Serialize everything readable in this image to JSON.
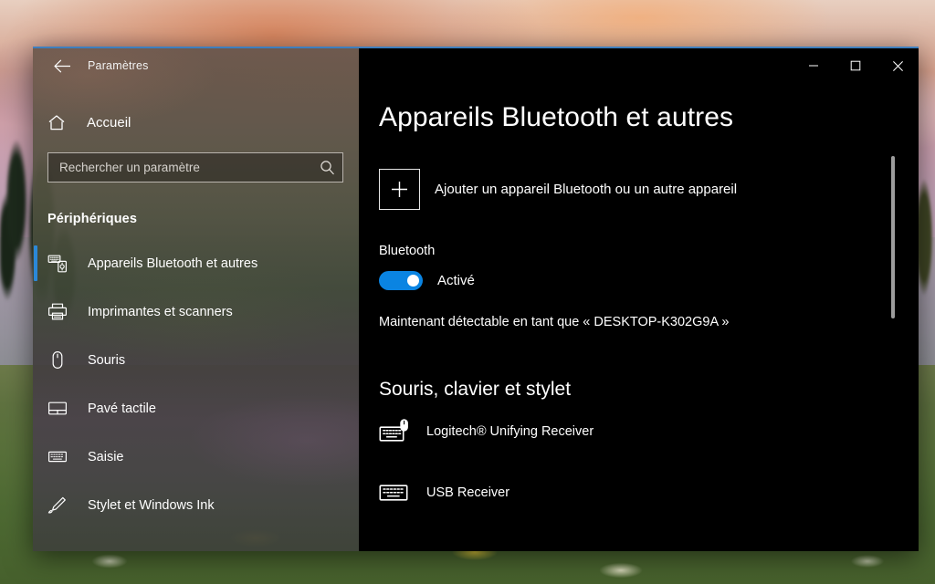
{
  "window": {
    "app_title": "Paramètres",
    "back_icon": "back-arrow-icon",
    "controls": {
      "minimize": "–",
      "maximize": "▢",
      "close": "✕",
      "minimize_name": "minimize-button",
      "maximize_name": "maximize-button",
      "close_name": "close-button"
    },
    "accent_color": "#0a84e2",
    "titlebar_border_color": "#3d7fbf"
  },
  "sidebar": {
    "home": {
      "label": "Accueil",
      "icon": "home-icon"
    },
    "search": {
      "placeholder": "Rechercher un paramètre",
      "value": "",
      "icon": "search-icon"
    },
    "section_title": "Périphériques",
    "items": [
      {
        "label": "Appareils Bluetooth et autres",
        "icon": "bluetooth-devices-icon",
        "selected": true
      },
      {
        "label": "Imprimantes et scanners",
        "icon": "printer-icon",
        "selected": false
      },
      {
        "label": "Souris",
        "icon": "mouse-icon",
        "selected": false
      },
      {
        "label": "Pavé tactile",
        "icon": "touchpad-icon",
        "selected": false
      },
      {
        "label": "Saisie",
        "icon": "typing-keyboard-icon",
        "selected": false
      },
      {
        "label": "Stylet et Windows Ink",
        "icon": "pen-icon",
        "selected": false
      }
    ],
    "selection_color": "#2b88d8"
  },
  "main": {
    "page_title": "Appareils Bluetooth et autres",
    "add_device": {
      "label": "Ajouter un appareil Bluetooth ou un autre appareil",
      "icon": "plus-icon"
    },
    "bluetooth": {
      "label": "Bluetooth",
      "toggle_state": "Activé",
      "toggle_on": true,
      "discoverable_text": "Maintenant détectable en tant que « DESKTOP-K302G9A »"
    },
    "devices_group": {
      "title": "Souris, clavier et stylet",
      "devices": [
        {
          "name": "Logitech® Unifying Receiver",
          "icon": "keyboard-mouse-icon"
        },
        {
          "name": "USB Receiver",
          "icon": "keyboard-icon"
        }
      ]
    },
    "scrollbar": {
      "name": "content-scrollbar"
    }
  }
}
